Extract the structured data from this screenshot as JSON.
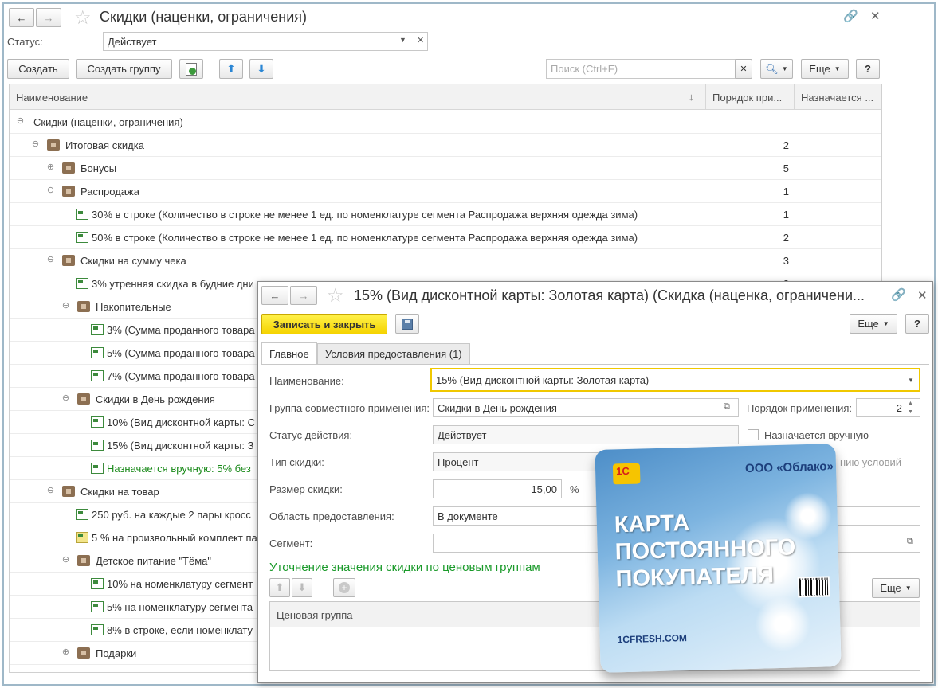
{
  "main": {
    "title": "Скидки (наценки, ограничения)",
    "status_label": "Статус:",
    "status_value": "Действует",
    "create": "Создать",
    "create_group": "Создать группу",
    "search_placeholder": "Поиск (Ctrl+F)",
    "more": "Еще",
    "help": "?",
    "columns": [
      "Наименование",
      "Порядок при...",
      "Назначается ..."
    ],
    "rows": [
      {
        "indent": 0,
        "exp": "⊖",
        "icon": "",
        "text": "Скидки (наценки, ограничения)",
        "order": ""
      },
      {
        "indent": 1,
        "exp": "⊖",
        "icon": "folder",
        "text": "Итоговая скидка",
        "order": "2"
      },
      {
        "indent": 2,
        "exp": "⊕",
        "icon": "folder",
        "text": "Бонусы",
        "order": "5"
      },
      {
        "indent": 2,
        "exp": "⊖",
        "icon": "folder",
        "text": "Распродажа",
        "order": "1"
      },
      {
        "indent": 3,
        "exp": "",
        "icon": "item",
        "text": "30% в строке (Количество в строке не менее 1 ед. по номенклатуре сегмента Распродажа верхняя одежда зима)",
        "order": "1"
      },
      {
        "indent": 3,
        "exp": "",
        "icon": "item",
        "text": "50% в строке (Количество в строке не менее 1 ед. по номенклатуре сегмента Распродажа верхняя одежда зима)",
        "order": "2"
      },
      {
        "indent": 2,
        "exp": "⊖",
        "icon": "folder",
        "text": "Скидки на сумму чека",
        "order": "3"
      },
      {
        "indent": 3,
        "exp": "",
        "icon": "item",
        "text": "3% утренняя скидка в будние дни",
        "order": "2"
      },
      {
        "indent": 3,
        "exp": "⊖",
        "icon": "folder",
        "text": "Накопительные",
        "order": ""
      },
      {
        "indent": 4,
        "exp": "",
        "icon": "item",
        "text": "3% (Сумма проданного товара",
        "order": ""
      },
      {
        "indent": 4,
        "exp": "",
        "icon": "item",
        "text": "5% (Сумма проданного товара",
        "order": ""
      },
      {
        "indent": 4,
        "exp": "",
        "icon": "item",
        "text": "7% (Сумма проданного товара",
        "order": ""
      },
      {
        "indent": 3,
        "exp": "⊖",
        "icon": "folder",
        "text": "Скидки в День рождения",
        "order": ""
      },
      {
        "indent": 4,
        "exp": "",
        "icon": "item",
        "text": "10% (Вид дисконтной карты: С",
        "order": ""
      },
      {
        "indent": 4,
        "exp": "",
        "icon": "item",
        "text": "15% (Вид дисконтной карты: З",
        "order": ""
      },
      {
        "indent": 4,
        "exp": "",
        "icon": "item",
        "text": "Назначается вручную: 5% без",
        "order": "",
        "green": true
      },
      {
        "indent": 2,
        "exp": "⊖",
        "icon": "folder",
        "text": "Скидки на товар",
        "order": ""
      },
      {
        "indent": 3,
        "exp": "",
        "icon": "item",
        "text": "250 руб. на каждые 2 пары кросс",
        "order": ""
      },
      {
        "indent": 3,
        "exp": "",
        "icon": "note",
        "text": "5 % на произвольный комплект па",
        "order": ""
      },
      {
        "indent": 3,
        "exp": "⊖",
        "icon": "folder",
        "text": "Детское питание \"Тёма\"",
        "order": ""
      },
      {
        "indent": 4,
        "exp": "",
        "icon": "item",
        "text": "10% на номенклатуру сегмент",
        "order": ""
      },
      {
        "indent": 4,
        "exp": "",
        "icon": "item",
        "text": "5% на номенклатуру сегмента",
        "order": ""
      },
      {
        "indent": 4,
        "exp": "",
        "icon": "item",
        "text": "8% в строке, если номенклату",
        "order": ""
      },
      {
        "indent": 3,
        "exp": "⊕",
        "icon": "folder",
        "text": "Подарки",
        "order": ""
      }
    ]
  },
  "dialog": {
    "title": "15% (Вид дисконтной карты: Золотая карта) (Скидка (наценка, ограничени...",
    "save_close": "Записать и закрыть",
    "more": "Еще",
    "help": "?",
    "tabs": [
      "Главное",
      "Условия предоставления (1)"
    ],
    "fields": {
      "name_label": "Наименование:",
      "name_value": "15% (Вид дисконтной карты: Золотая карта)",
      "group_label": "Группа совместного применения:",
      "group_value": "Скидки в День рождения",
      "order_label": "Порядок применения:",
      "order_value": "2",
      "status_label": "Статус действия:",
      "status_value": "Действует",
      "manual_label": "Назначается вручную",
      "type_label": "Тип скидки:",
      "type_value": "Процент",
      "conditions_fragment": "нию условий",
      "size_label": "Размер скидки:",
      "size_value": "15,00",
      "size_unit": "%",
      "area_label": "Область предоставления:",
      "area_value": "В документе",
      "segment_label": "Сегмент:",
      "segment_value": ""
    },
    "section_title": "Уточнение значения скидки по ценовым группам",
    "grid_more": "Еще",
    "grid_col1": "Ценовая группа",
    "grid_col2_fragment": "е"
  },
  "card": {
    "org": "ООО «Облако»",
    "line1": "КАРТА",
    "line2": "ПОСТОЯННОГО",
    "line3": "ПОКУПАТЕЛЯ",
    "url": "1CFRESH.COM",
    "logo": "1C"
  },
  "colors": {
    "accent_yellow": "#f5d300",
    "green_text": "#1a8a1a",
    "border_blue": "#9fb8c8"
  }
}
